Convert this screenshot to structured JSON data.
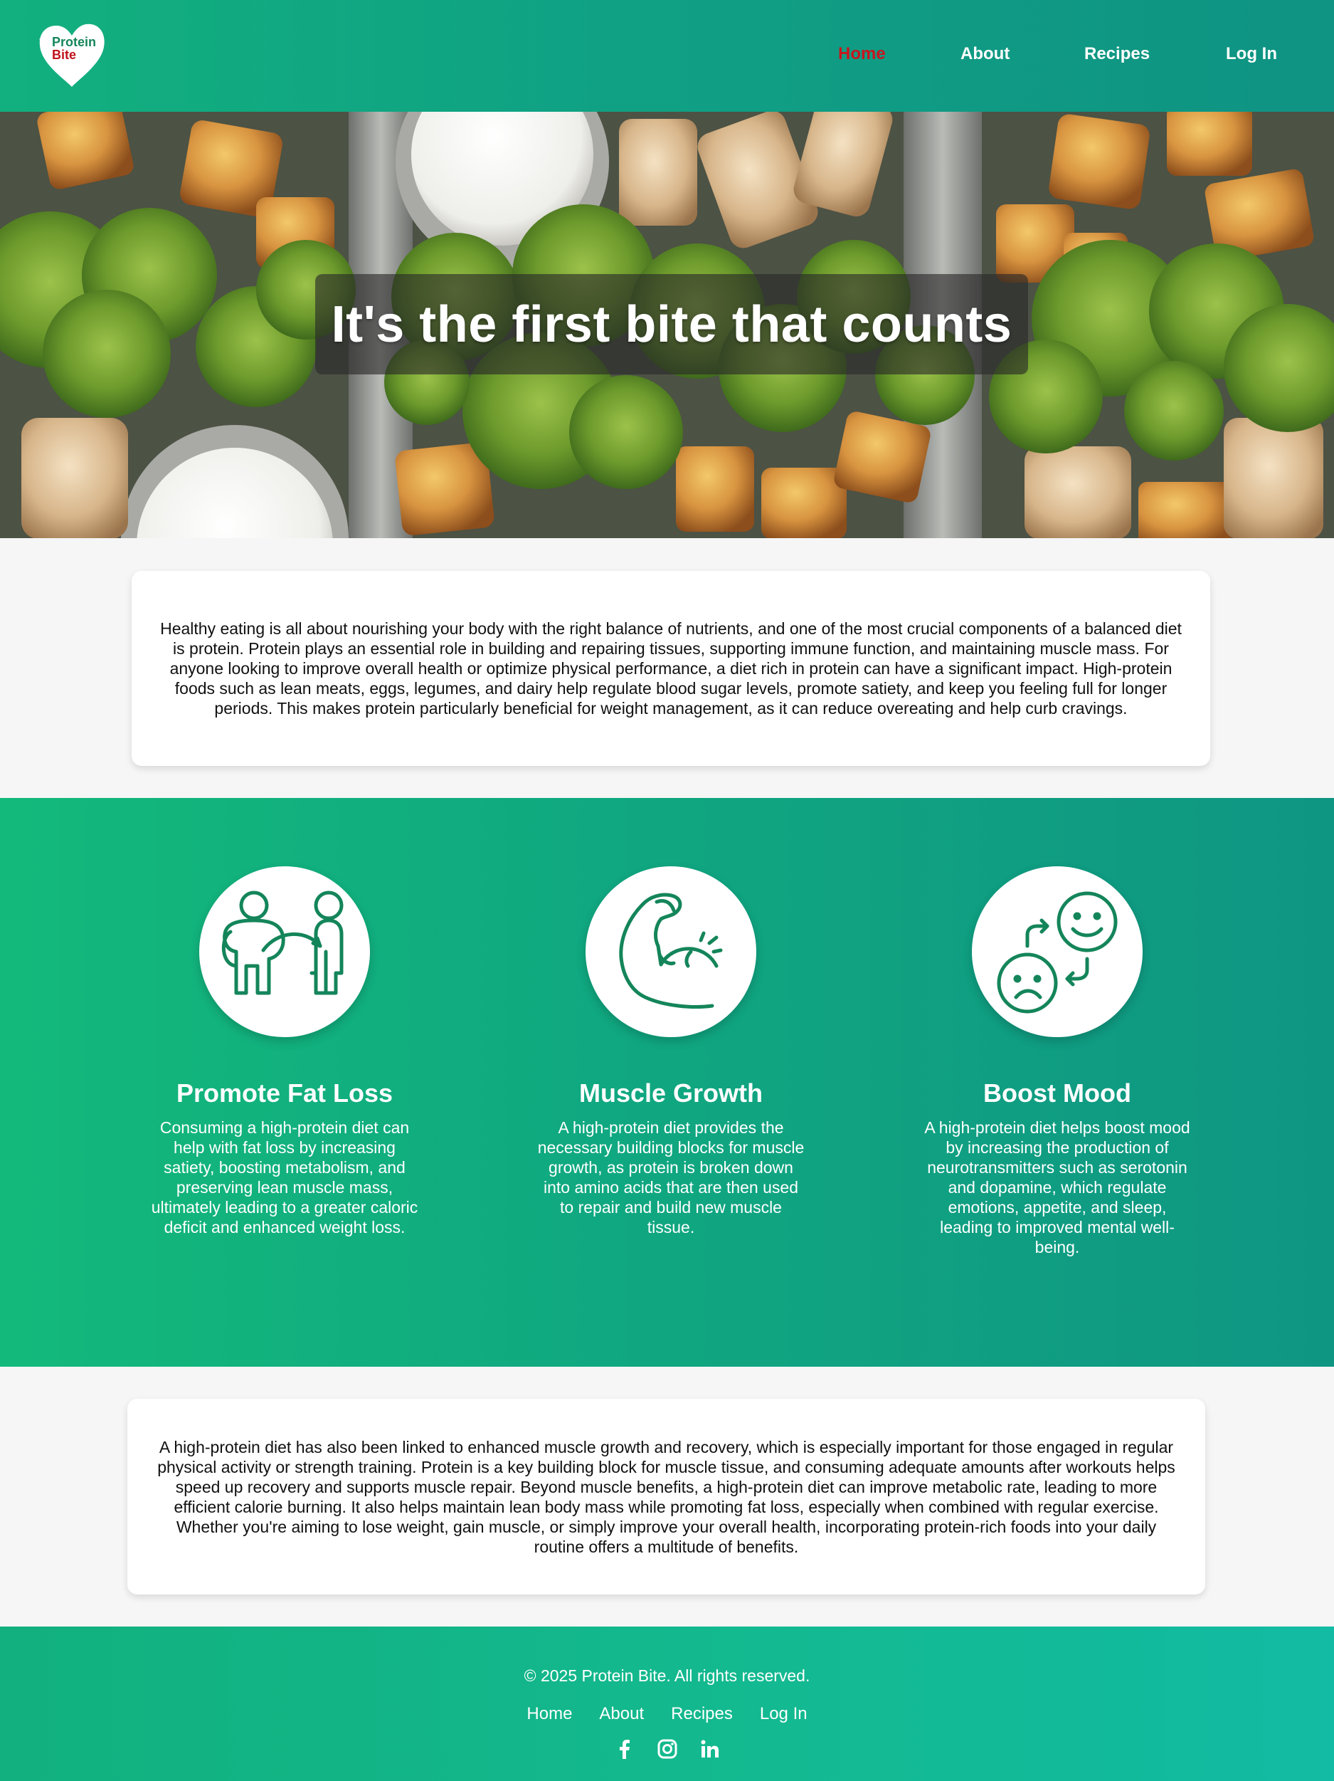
{
  "brand": {
    "logo_line1": "Protein",
    "logo_line2": "Bite",
    "icon": "heart-logo-icon"
  },
  "nav": {
    "items": [
      {
        "label": "Home",
        "active": true
      },
      {
        "label": "About",
        "active": false
      },
      {
        "label": "Recipes",
        "active": false
      },
      {
        "label": "Log In",
        "active": false
      }
    ]
  },
  "hero": {
    "title": "It's the first bite that counts"
  },
  "intro": {
    "text": "Healthy eating is all about nourishing your body with the right balance of nutrients, and one of the most crucial components of a balanced diet is protein. Protein plays an essential role in building and repairing tissues, supporting immune function, and maintaining muscle mass. For anyone looking to improve overall health or optimize physical performance, a diet rich in protein can have a significant impact. High-protein foods such as lean meats, eggs, legumes, and dairy help regulate blood sugar levels, promote satiety, and keep you feeling full for longer periods. This makes protein particularly beneficial for weight management, as it can reduce overeating and help curb cravings."
  },
  "benefits": [
    {
      "icon": "weight-loss-icon",
      "title": "Promote Fat Loss",
      "text": "Consuming a high-protein diet can help with fat loss by increasing satiety, boosting metabolism, and preserving lean muscle mass, ultimately leading to a greater caloric deficit and enhanced weight loss."
    },
    {
      "icon": "flexed-bicep-icon",
      "title": "Muscle Growth",
      "text": "A high-protein diet provides the necessary building blocks for muscle growth, as protein is broken down into amino acids that are then used to repair and build new muscle tissue."
    },
    {
      "icon": "mood-swap-icon",
      "title": "Boost Mood",
      "text": "A high-protein diet helps boost mood by increasing the production of neurotransmitters such as serotonin and dopamine, which regulate emotions, appetite, and sleep, leading to improved mental well-being."
    }
  ],
  "outro": {
    "text": "A high-protein diet has also been linked to enhanced muscle growth and recovery, which is especially important for those engaged in regular physical activity or strength training. Protein is a key building block for muscle tissue, and consuming adequate amounts after workouts helps speed up recovery and supports muscle repair. Beyond muscle benefits, a high-protein diet can improve metabolic rate, leading to more efficient calorie burning. It also helps maintain lean body mass while promoting fat loss, especially when combined with regular exercise. Whether you're aiming to lose weight, gain muscle, or simply improve your overall health, incorporating protein-rich foods into your daily routine offers a multitude of benefits."
  },
  "footer": {
    "copyright": "© 2025 Protein Bite. All rights reserved.",
    "links": [
      "Home",
      "About",
      "Recipes",
      "Log In"
    ],
    "socials": [
      "facebook-icon",
      "instagram-icon",
      "linkedin-icon"
    ]
  },
  "colors": {
    "brand_green": "#12b07e",
    "teal": "#0f9383",
    "active_nav": "#c8151f",
    "icon_stroke": "#14855a"
  }
}
